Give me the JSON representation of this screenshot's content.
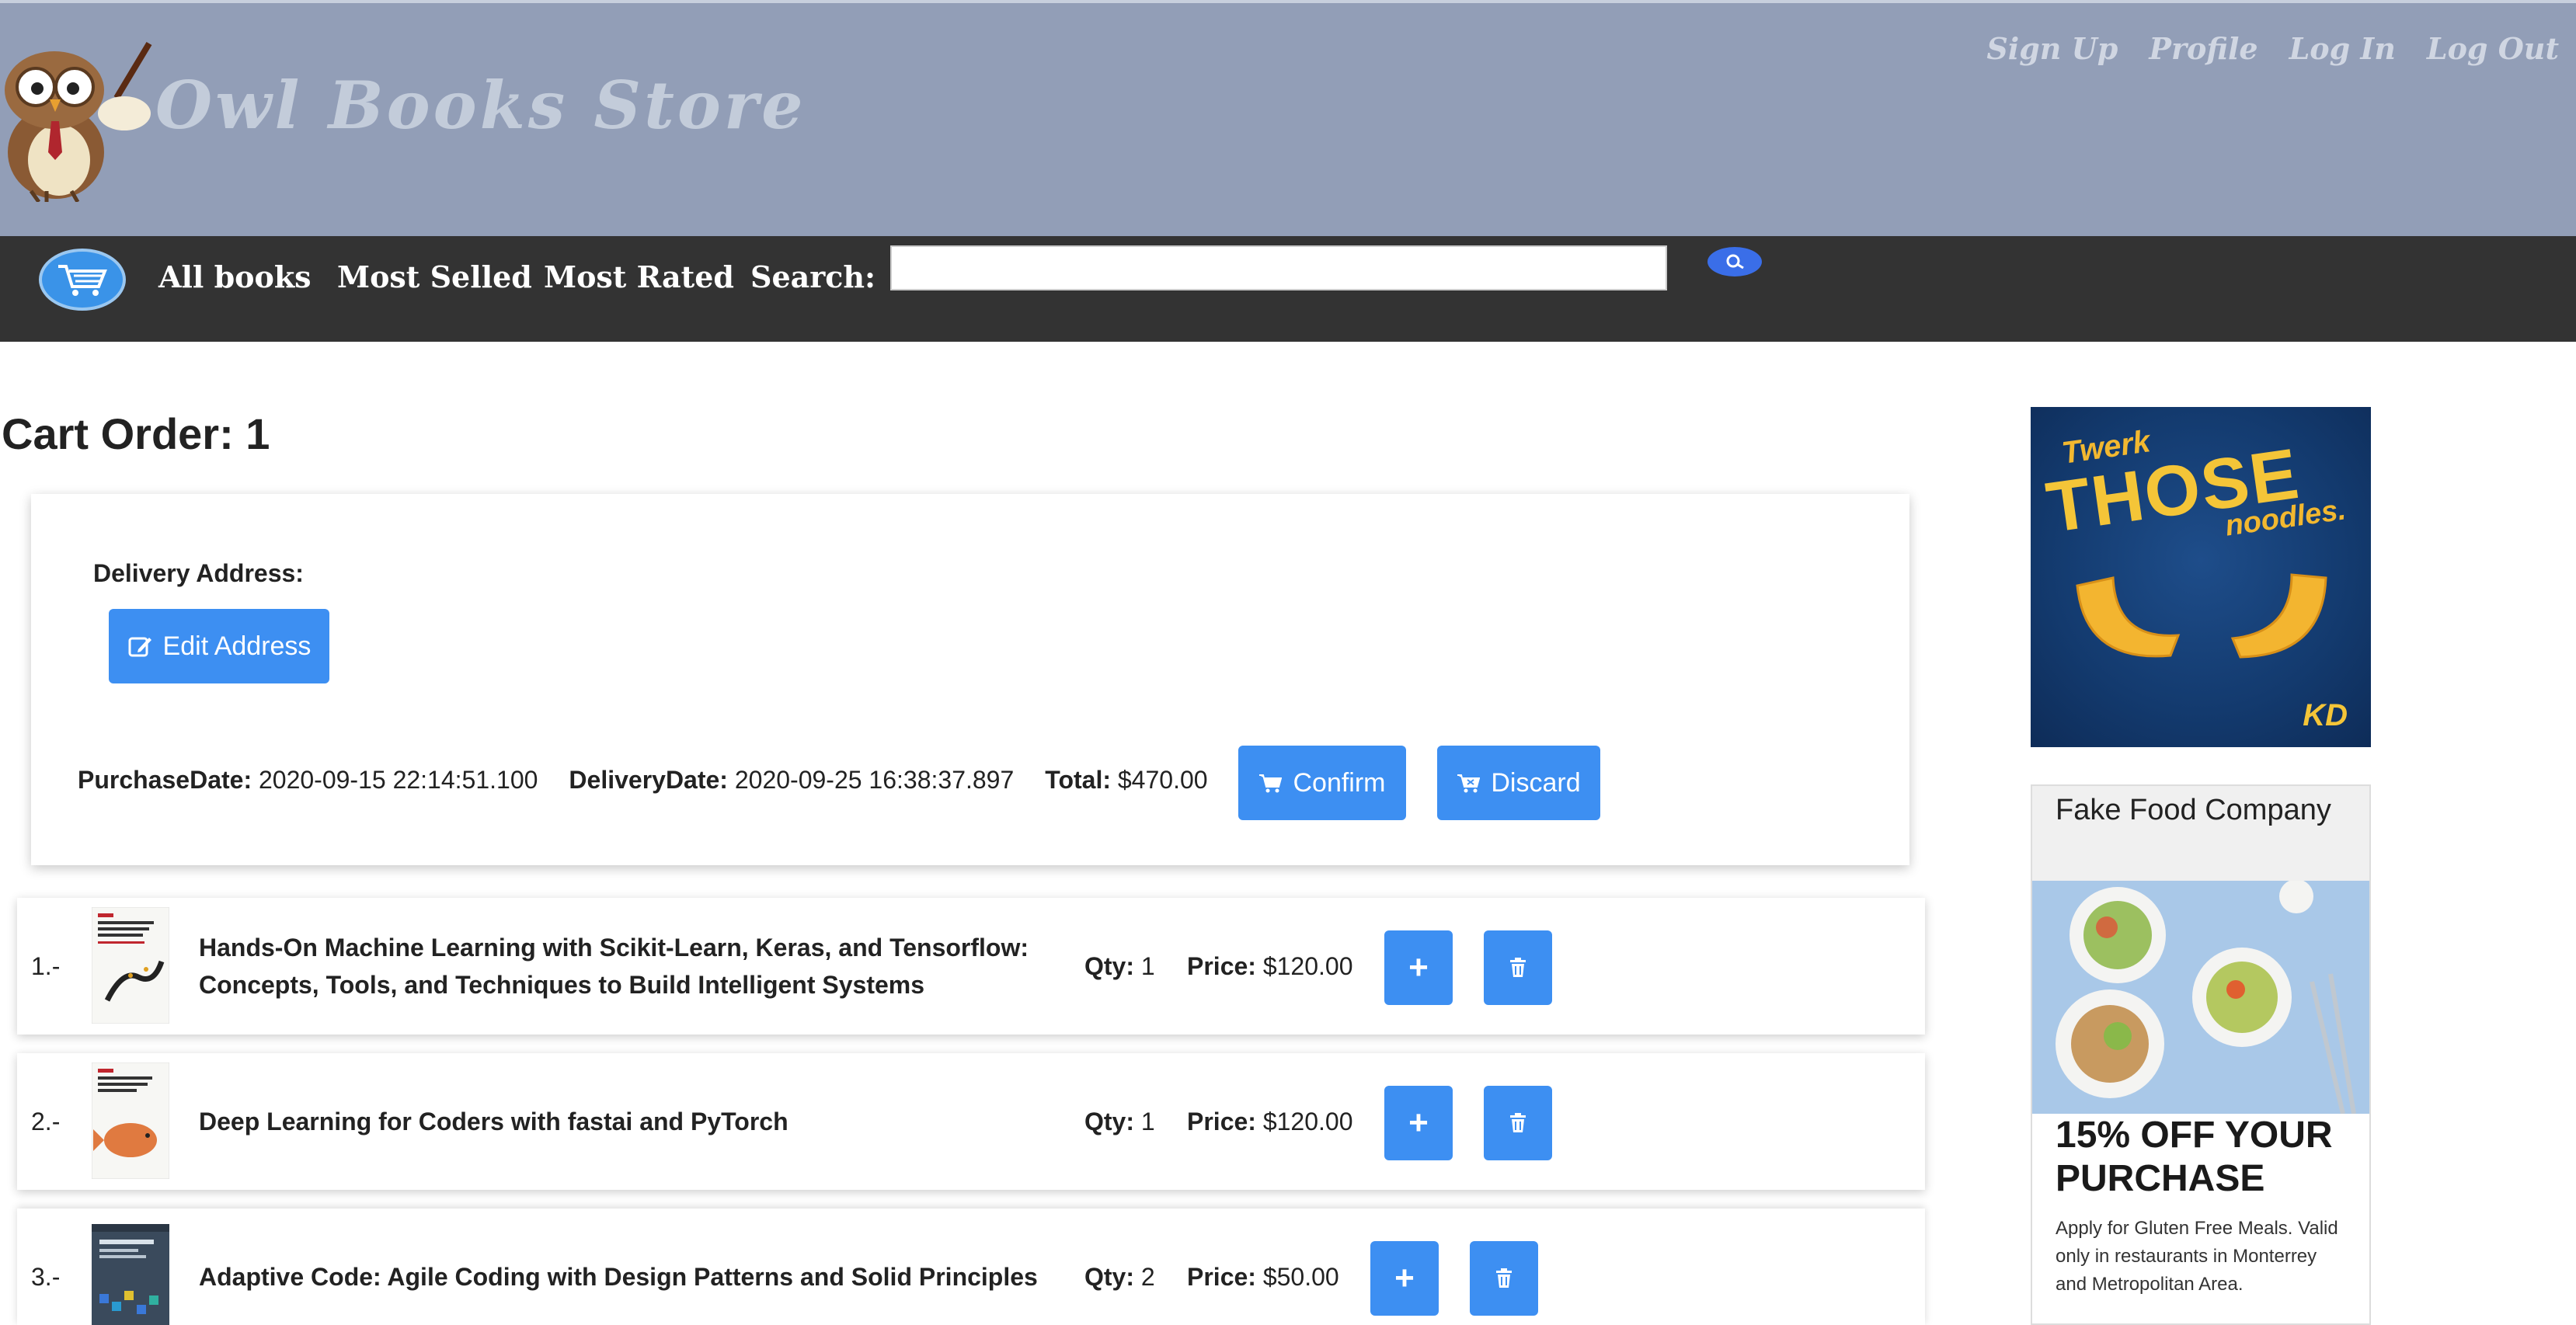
{
  "header": {
    "store_name": "Owl Books Store",
    "links": [
      "Sign Up",
      "Profile",
      "Log In",
      "Log Out"
    ]
  },
  "nav": {
    "items": [
      "All books",
      "Most Selled",
      "Most Rated"
    ],
    "search_label": "Search:",
    "search_value": ""
  },
  "cart": {
    "title": "Cart Order: 1",
    "delivery_label": "Delivery Address:",
    "edit_address_label": "Edit Address",
    "purchase_date_label": "PurchaseDate:",
    "purchase_date": "2020-09-15 22:14:51.100",
    "delivery_date_label": "DeliveryDate:",
    "delivery_date": "2020-09-25 16:38:37.897",
    "total_label": "Total:",
    "total": "$470.00",
    "confirm_label": "Confirm",
    "discard_label": "Discard",
    "qty_label": "Qty:",
    "price_label": "Price:",
    "items": [
      {
        "index": "1.-",
        "title": "Hands-On Machine Learning with Scikit-Learn, Keras, and Tensorflow: Concepts, Tools, and Techniques to Build Intelligent Systems",
        "qty": "1",
        "price": "$120.00"
      },
      {
        "index": "2.-",
        "title": "Deep Learning for Coders with fastai and PyTorch",
        "qty": "1",
        "price": "$120.00"
      },
      {
        "index": "3.-",
        "title": "Adaptive Code: Agile Coding with Design Patterns and Solid Principles",
        "qty": "2",
        "price": "$50.00"
      }
    ]
  },
  "ads": {
    "ad1": {
      "line1": "Twerk",
      "line2": "THOSE",
      "line3": "noodles.",
      "brand": "KD"
    },
    "ad2": {
      "company": "Fake Food Company",
      "headline": "15% OFF YOUR PURCHASE",
      "body": "Apply for Gluten Free Meals. Valid only in restaurants in Monterrey and Metropolitan Area."
    }
  },
  "colors": {
    "header_bg": "#929eb7",
    "nav_bg": "#333333",
    "accent": "#3d8ff2"
  }
}
